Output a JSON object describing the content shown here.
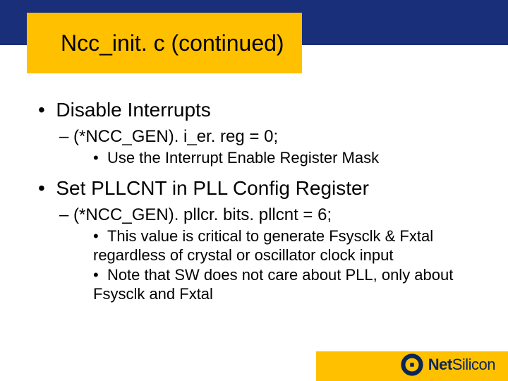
{
  "title": "Ncc_init. c (continued)",
  "bullets": {
    "a": {
      "head": "Disable Interrupts",
      "sub": "(*NCC_GEN). i_er. reg = 0;",
      "note": "Use the Interrupt Enable Register Mask"
    },
    "b": {
      "head": "Set PLLCNT in PLL Config Register",
      "sub": "(*NCC_GEN). pllcr. bits. pllcnt = 6;",
      "note1": "This value is critical to generate Fsysclk & Fxtal regardless of crystal or oscillator clock input",
      "note2": "Note that SW does not care about PLL, only about Fsysclk and Fxtal"
    }
  },
  "brand": {
    "bold": "Net",
    "rest": "Silicon"
  }
}
